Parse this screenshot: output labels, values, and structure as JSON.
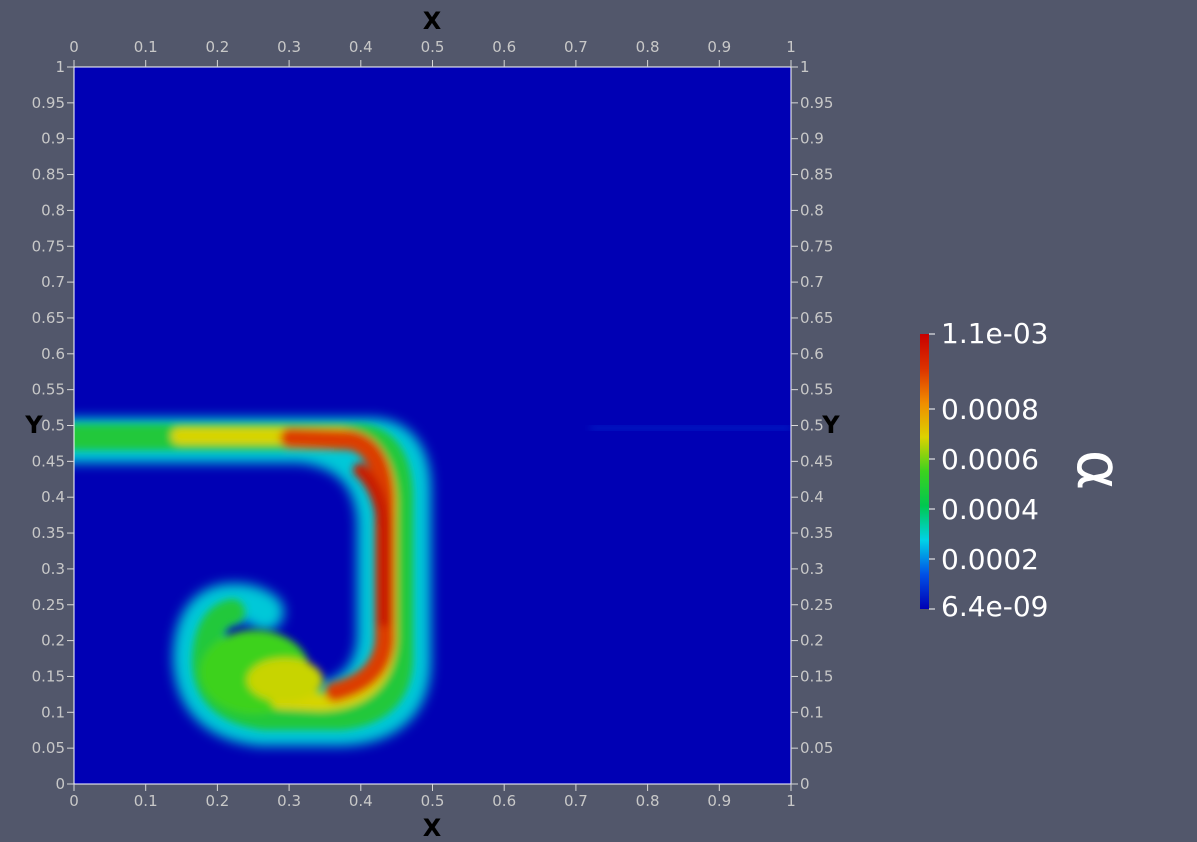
{
  "chart_data": {
    "type": "heatmap",
    "x_axis_label": "X",
    "y_axis_label": "Y",
    "xlim": [
      0,
      1
    ],
    "ylim": [
      0,
      1
    ],
    "x_ticks": [
      "0",
      "0.1",
      "0.2",
      "0.3",
      "0.4",
      "0.5",
      "0.6",
      "0.7",
      "0.8",
      "0.9",
      "1"
    ],
    "y_ticks": [
      "0",
      "0.05",
      "0.1",
      "0.15",
      "0.2",
      "0.25",
      "0.3",
      "0.35",
      "0.4",
      "0.45",
      "0.5",
      "0.55",
      "0.6",
      "0.65",
      "0.7",
      "0.75",
      "0.8",
      "0.85",
      "0.9",
      "0.95",
      "1"
    ],
    "field_name": "α",
    "colorbar": {
      "min_label": "6.4e-09",
      "max_label": "1.1e-03",
      "min": 6.4e-09,
      "max": 0.0011,
      "ticks": [
        {
          "value": 0.0008,
          "label": "0.0008"
        },
        {
          "value": 0.0006,
          "label": "0.0006"
        },
        {
          "value": 0.0004,
          "label": "0.0004"
        },
        {
          "value": 0.0002,
          "label": "0.0002"
        }
      ],
      "colormap": [
        "#0000b4",
        "#0050e6",
        "#00d2e6",
        "#00c850",
        "#3cd21e",
        "#dcd200",
        "#f08c00",
        "#dc3200",
        "#c80000"
      ]
    },
    "background_value": 6.4e-09,
    "structure": {
      "description_values": "filament of high alpha along y≈0.49 from x=0 to x≈0.45, bending down to form a curved tongue ending near (0.25,0.15)",
      "peak_value": 0.00105
    }
  }
}
